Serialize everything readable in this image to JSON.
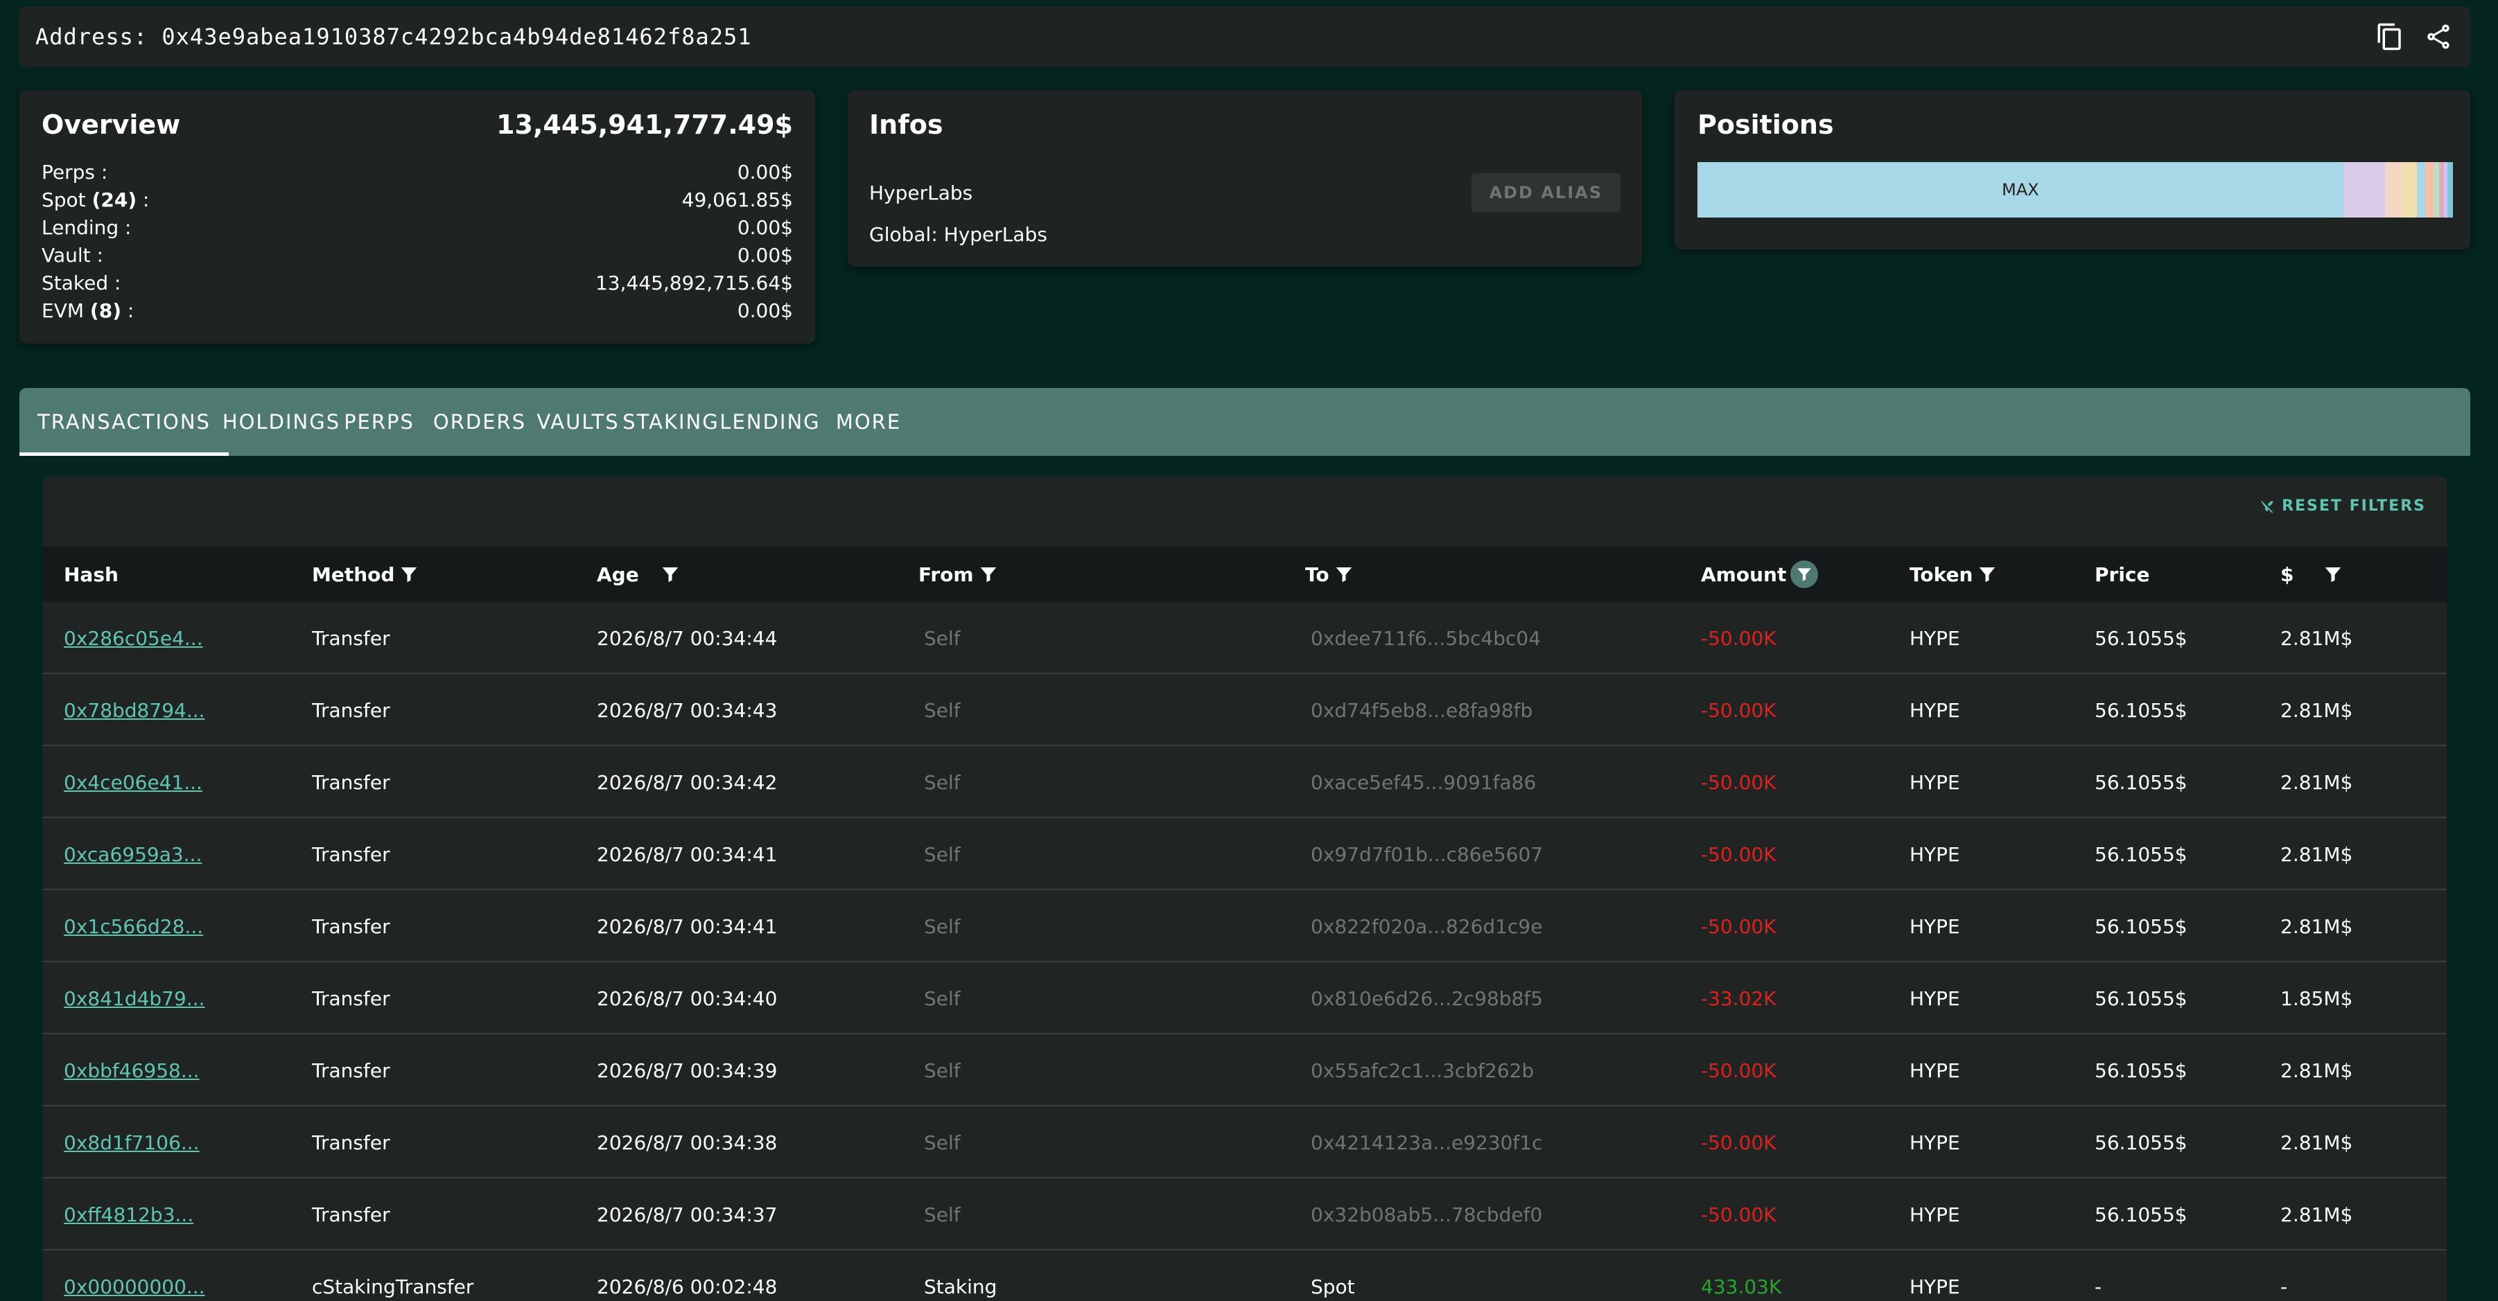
{
  "address": {
    "label": "Address: 0x43e9abea1910387c4292bca4b94de81462f8a251"
  },
  "overview": {
    "title": "Overview",
    "total": "13,445,941,777.49$",
    "rows": [
      {
        "label": "Perps :",
        "count": "",
        "value": "0.00$"
      },
      {
        "label": "Spot",
        "count": "(24)",
        "suffix": ":",
        "value": "49,061.85$"
      },
      {
        "label": "Lending :",
        "count": "",
        "value": "0.00$"
      },
      {
        "label": "Vault :",
        "count": "",
        "value": "0.00$"
      },
      {
        "label": "Staked :",
        "count": "",
        "value": "13,445,892,715.64$"
      },
      {
        "label": "EVM",
        "count": "(8)",
        "suffix": ":",
        "value": "0.00$"
      }
    ]
  },
  "infos": {
    "title": "Infos",
    "alias_name": "HyperLabs",
    "add_alias_label": "ADD ALIAS",
    "global_label": "Global: HyperLabs"
  },
  "positions": {
    "title": "Positions",
    "segments": [
      {
        "label": "MAX",
        "share": 0.855,
        "color": "#a8d8e8"
      },
      {
        "label": "",
        "share": 0.055,
        "color": "#d8cce8"
      },
      {
        "label": "",
        "share": 0.022,
        "color": "#f2d8c4"
      },
      {
        "label": "",
        "share": 0.02,
        "color": "#f0e0b0"
      },
      {
        "label": "",
        "share": 0.012,
        "color": "#a8d8e8"
      },
      {
        "label": "",
        "share": 0.01,
        "color": "#f8c0a8"
      },
      {
        "label": "",
        "share": 0.008,
        "color": "#b8e0c0"
      },
      {
        "label": "",
        "share": 0.006,
        "color": "#e8a8b8"
      },
      {
        "label": "",
        "share": 0.005,
        "color": "#c8c8f0"
      },
      {
        "label": "",
        "share": 0.007,
        "color": "#80c8d8"
      }
    ]
  },
  "tabs": [
    {
      "label": "TRANSACTIONS",
      "active": true
    },
    {
      "label": "HOLDINGS",
      "active": false
    },
    {
      "label": "PERPS",
      "active": false
    },
    {
      "label": "ORDERS",
      "active": false
    },
    {
      "label": "VAULTS",
      "active": false
    },
    {
      "label": "STAKING",
      "active": false
    },
    {
      "label": "LENDING",
      "active": false
    },
    {
      "label": "MORE",
      "active": false
    }
  ],
  "table": {
    "reset_filters_label": "RESET FILTERS",
    "columns": [
      {
        "label": "Hash",
        "filter": false
      },
      {
        "label": "Method",
        "filter": true
      },
      {
        "label": "Age",
        "filter": true
      },
      {
        "label": "From",
        "filter": true
      },
      {
        "label": "To",
        "filter": true
      },
      {
        "label": "Amount",
        "filter": true,
        "active": true
      },
      {
        "label": "Token",
        "filter": true
      },
      {
        "label": "Price",
        "filter": false
      },
      {
        "label": "$",
        "filter": true
      }
    ],
    "rows": [
      {
        "hash": "0x286c05e4...",
        "method": "Transfer",
        "age": "2026/8/7 00:34:44",
        "from": "Self",
        "to": "0xdee711f6...5bc4bc04",
        "amount": "-50.00K",
        "token": "HYPE",
        "price": "56.1055$",
        "usd": "2.81M$"
      },
      {
        "hash": "0x78bd8794...",
        "method": "Transfer",
        "age": "2026/8/7 00:34:43",
        "from": "Self",
        "to": "0xd74f5eb8...e8fa98fb",
        "amount": "-50.00K",
        "token": "HYPE",
        "price": "56.1055$",
        "usd": "2.81M$"
      },
      {
        "hash": "0x4ce06e41...",
        "method": "Transfer",
        "age": "2026/8/7 00:34:42",
        "from": "Self",
        "to": "0xace5ef45...9091fa86",
        "amount": "-50.00K",
        "token": "HYPE",
        "price": "56.1055$",
        "usd": "2.81M$"
      },
      {
        "hash": "0xca6959a3...",
        "method": "Transfer",
        "age": "2026/8/7 00:34:41",
        "from": "Self",
        "to": "0x97d7f01b...c86e5607",
        "amount": "-50.00K",
        "token": "HYPE",
        "price": "56.1055$",
        "usd": "2.81M$"
      },
      {
        "hash": "0x1c566d28...",
        "method": "Transfer",
        "age": "2026/8/7 00:34:41",
        "from": "Self",
        "to": "0x822f020a...826d1c9e",
        "amount": "-50.00K",
        "token": "HYPE",
        "price": "56.1055$",
        "usd": "2.81M$"
      },
      {
        "hash": "0x841d4b79...",
        "method": "Transfer",
        "age": "2026/8/7 00:34:40",
        "from": "Self",
        "to": "0x810e6d26...2c98b8f5",
        "amount": "-33.02K",
        "token": "HYPE",
        "price": "56.1055$",
        "usd": "1.85M$"
      },
      {
        "hash": "0xbbf46958...",
        "method": "Transfer",
        "age": "2026/8/7 00:34:39",
        "from": "Self",
        "to": "0x55afc2c1...3cbf262b",
        "amount": "-50.00K",
        "token": "HYPE",
        "price": "56.1055$",
        "usd": "2.81M$"
      },
      {
        "hash": "0x8d1f7106...",
        "method": "Transfer",
        "age": "2026/8/7 00:34:38",
        "from": "Self",
        "to": "0x4214123a...e9230f1c",
        "amount": "-50.00K",
        "token": "HYPE",
        "price": "56.1055$",
        "usd": "2.81M$"
      },
      {
        "hash": "0xff4812b3...",
        "method": "Transfer",
        "age": "2026/8/7 00:34:37",
        "from": "Self",
        "to": "0x32b08ab5...78cbdef0",
        "amount": "-50.00K",
        "token": "HYPE",
        "price": "56.1055$",
        "usd": "2.81M$"
      },
      {
        "hash": "0x00000000...",
        "method": "cStakingTransfer",
        "age": "2026/8/6 00:02:48",
        "from": "Staking",
        "to": "Spot",
        "amount": "433.03K",
        "token": "HYPE",
        "price": "-",
        "usd": "-"
      }
    ]
  },
  "colors": {
    "accent": "#5fc5b3",
    "tab_bar": "#4f7a70",
    "negative": "#e0201c",
    "positive": "#2ba42b",
    "background": "#04241e",
    "card": "#1f2322"
  }
}
